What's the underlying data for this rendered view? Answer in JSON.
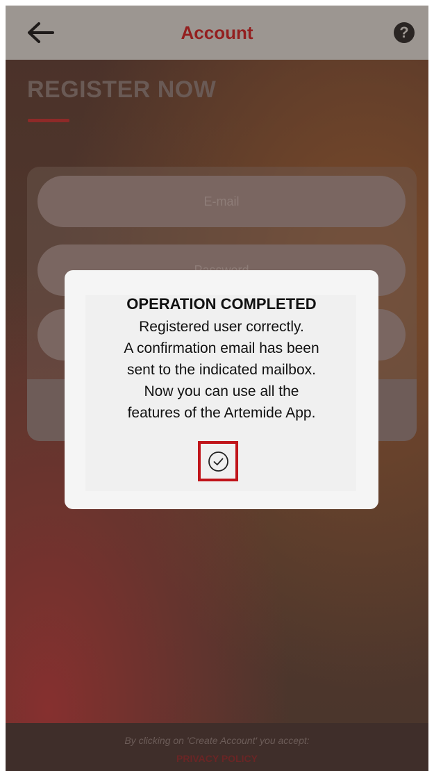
{
  "header": {
    "title": "Account",
    "back_icon": "back-arrow-icon",
    "help_icon": "help-icon",
    "help_glyph": "?"
  },
  "page": {
    "title": "REGISTER NOW"
  },
  "form": {
    "email_placeholder": "E-mail",
    "password_placeholder": "Password"
  },
  "dialog": {
    "title": "OPERATION COMPLETED",
    "lines": [
      "Registered user correctly.",
      "A confirmation email has been",
      "sent to the indicated mailbox.",
      "Now you can use all the",
      "features of the Artemide App."
    ],
    "confirm_icon": "check-circle-icon"
  },
  "footer": {
    "note": "By clicking on 'Create Account' you accept:",
    "privacy_link": "PRIVACY POLICY"
  },
  "colors": {
    "accent": "#931f1f",
    "highlight_box": "#c0141a",
    "header_bg": "#9c9691"
  }
}
